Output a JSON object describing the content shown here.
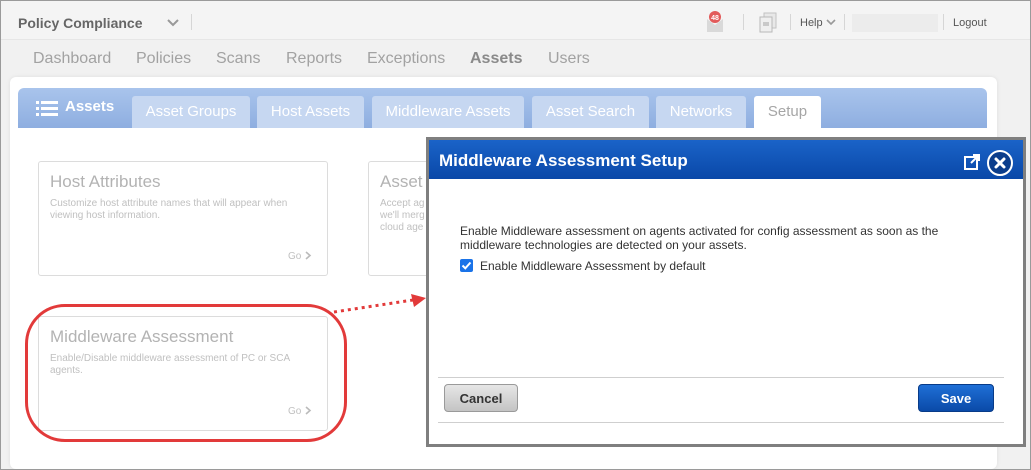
{
  "topbar": {
    "app_name": "Policy Compliance",
    "help_label": "Help",
    "logout_label": "Logout",
    "notification_count": "48"
  },
  "main_nav": {
    "items": [
      "Dashboard",
      "Policies",
      "Scans",
      "Reports",
      "Exceptions",
      "Assets",
      "Users"
    ],
    "active": "Assets"
  },
  "module": {
    "title": "Assets",
    "tabs": [
      "Asset Groups",
      "Host Assets",
      "Middleware Assets",
      "Asset Search",
      "Networks",
      "Setup"
    ],
    "active_tab": "Setup"
  },
  "cards": [
    {
      "title": "Host Attributes",
      "description": "Customize host attribute names that will appear when viewing host information.",
      "go_label": "Go"
    },
    {
      "title": "Asset",
      "description_lines": [
        "Accept ag",
        "we'll merg",
        "cloud age"
      ]
    },
    {
      "title": "Middleware Assessment",
      "description": "Enable/Disable middleware assessment of PC or SCA agents.",
      "go_label": "Go"
    }
  ],
  "dialog": {
    "title": "Middleware Assessment Setup",
    "message": "Enable Middleware assessment on agents activated for config assessment as soon as the middleware technologies are detected on your assets.",
    "checkbox_label": "Enable Middleware Assessment by default",
    "checkbox_checked": true,
    "cancel_label": "Cancel",
    "save_label": "Save"
  },
  "colors": {
    "dialog_header": "#0a48a8",
    "tab_bar": "#9ab7e6",
    "annotation": "#e23a3a",
    "save_button": "#1a5fc4"
  },
  "icons": [
    "chevron-down-icon",
    "notification-icon",
    "document-icon",
    "menu-icon",
    "popout-icon",
    "close-icon",
    "chevron-right-icon",
    "checkmark-icon"
  ]
}
